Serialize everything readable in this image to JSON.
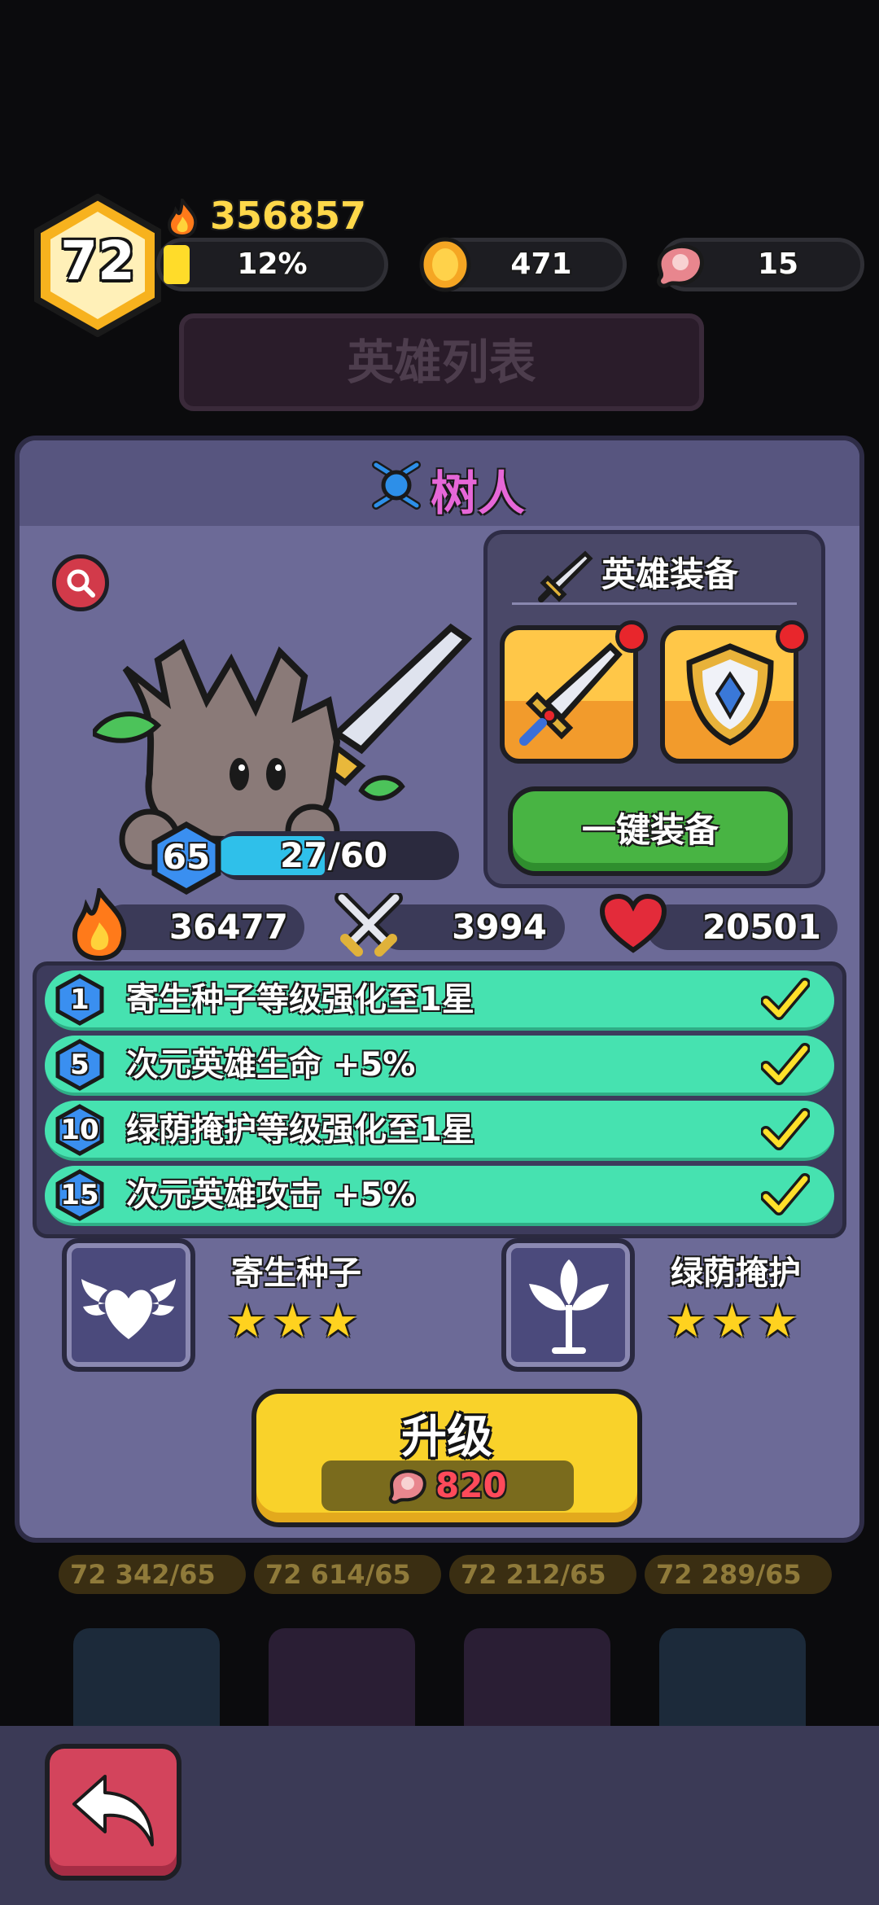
{
  "player": {
    "level": "72",
    "power": "356857",
    "xp_percent_label": "12%",
    "xp_fraction": 0.12,
    "coins": "471",
    "meat": "15"
  },
  "background": {
    "banner_title": "英雄列表",
    "hero_tags": [
      "72 342/65",
      "72 614/65",
      "72 212/65",
      "72 289/65"
    ]
  },
  "hero": {
    "name": "树人",
    "level": "65",
    "shards": "27/60",
    "shard_fraction": 0.45,
    "power": "36477",
    "attack": "3994",
    "health": "20501"
  },
  "equipment": {
    "title": "英雄装备",
    "slots": [
      {
        "item": "sword-icon",
        "has_notice": true
      },
      {
        "item": "shield-icon",
        "has_notice": true
      }
    ],
    "equip_all_label": "一键装备"
  },
  "bonuses": [
    {
      "level": "1",
      "text": "寄生种子等级强化至1星",
      "done": true
    },
    {
      "level": "5",
      "text": "次元英雄生命  +5%",
      "done": true
    },
    {
      "level": "10",
      "text": "绿荫掩护等级强化至1星",
      "done": true
    },
    {
      "level": "15",
      "text": "次元英雄攻击  +5%",
      "done": true
    }
  ],
  "skills": [
    {
      "name": "寄生种子",
      "stars": 3,
      "icon": "wings-icon"
    },
    {
      "name": "绿荫掩护",
      "stars": 3,
      "icon": "sprout-icon"
    }
  ],
  "upgrade": {
    "label": "升级",
    "cost": "820"
  },
  "colors": {
    "panel": "#6c6a97",
    "bonus_row": "#46e2b0",
    "upgrade_button": "#f9d22a",
    "equip_button": "#48b443",
    "hero_name": "#e667d8",
    "back_button": "#d3445c"
  }
}
